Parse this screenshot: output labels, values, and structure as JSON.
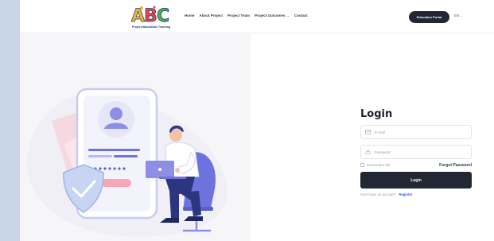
{
  "header": {
    "logo_letters": "ABC",
    "logo_tagline": "Project Naturalistic Teaching",
    "nav": [
      {
        "label": "Home"
      },
      {
        "label": "About Project"
      },
      {
        "label": "Project Team"
      },
      {
        "label": "Project Outcomes",
        "has_dropdown": true
      },
      {
        "label": "Contact"
      }
    ],
    "portal_button": "Education Portal",
    "language": "EN"
  },
  "login": {
    "title": "Login",
    "email_placeholder": "E-mail",
    "password_placeholder": "Password",
    "remember_label": "Remember Me",
    "forgot_label": "Forgot Password",
    "submit_label": "Login",
    "no_account_text": "Don't have an account?",
    "register_label": "Register"
  },
  "colors": {
    "dark_button": "#222733",
    "link_blue": "#3561d6",
    "illustration_purple": "#7c7ee0",
    "illustration_pink": "#f6a6b7",
    "background_blue": "#c9d6ea"
  },
  "icons": {
    "email": "envelope-icon",
    "password": "lock-icon",
    "dropdown": "chevron-down-icon"
  }
}
